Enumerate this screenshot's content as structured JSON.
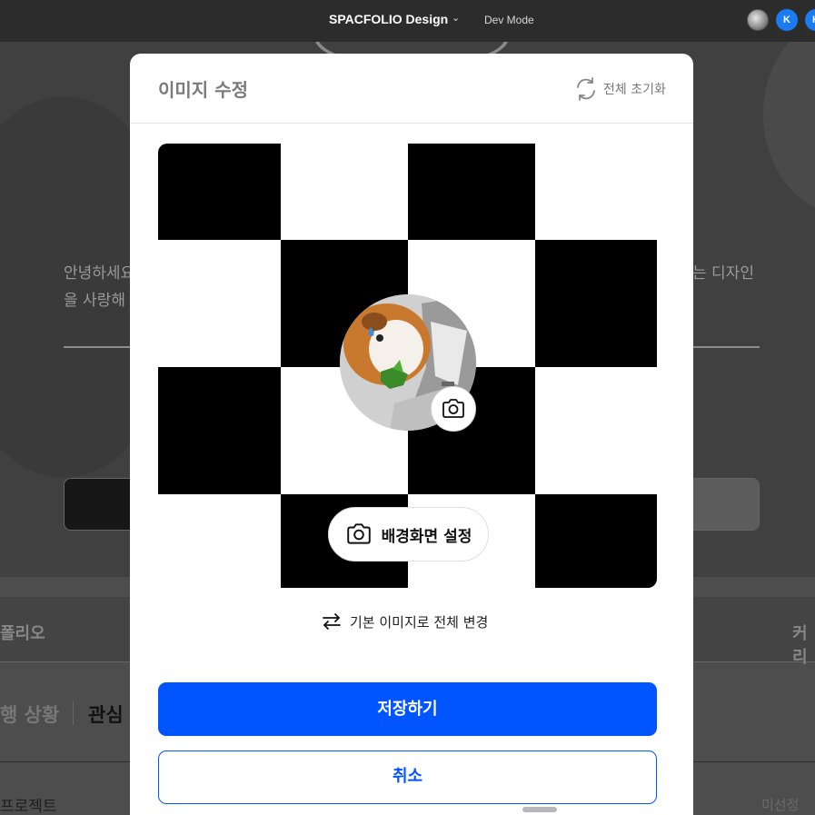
{
  "topbar": {
    "file_name": "SPACFOLIO Design",
    "chevron": "⌄",
    "dev_mode": "Dev Mode",
    "collaborators": [
      "K",
      "K"
    ]
  },
  "background": {
    "intro_line1": "안녕하세요",
    "intro_line2": "을 사랑해",
    "intro_line3": "는 디자인",
    "tab_left": "폴리오",
    "tab_right": "커리",
    "sub_tab_1": "행 상황",
    "sub_tab_2": "관심",
    "project_label": "프로젝트",
    "unselected_label": "미선정"
  },
  "modal": {
    "title": "이미지 수정",
    "reset_label": "전체 초기화",
    "reset_icon": "refresh-icon",
    "bg_button_label": "배경화면 설정",
    "bg_button_icon": "camera-icon",
    "profile_camera_icon": "camera-icon",
    "change_all_label": "기본 이미지로 전체 변경",
    "change_all_icon": "swap-arrows-icon",
    "save_label": "저장하기",
    "cancel_label": "취소"
  },
  "colors": {
    "primary": "#0055ff",
    "checker_dark": "#000000",
    "checker_light": "#ffffff",
    "overlay": "#3a3a3a"
  }
}
